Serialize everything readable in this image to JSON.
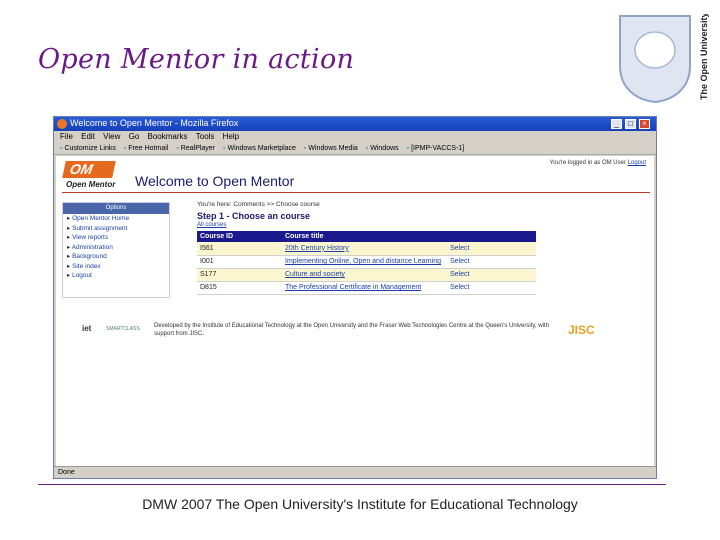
{
  "slide": {
    "title": "Open Mentor in action",
    "footer": "DMW 2007 The Open University's Institute for Educational Technology",
    "logo_caption": "The Open University",
    "accent_color": "#6a1a86"
  },
  "browser": {
    "window_title": "Welcome to Open Mentor - Mozilla Firefox",
    "menu": [
      "File",
      "Edit",
      "View",
      "Go",
      "Bookmarks",
      "Tools",
      "Help"
    ],
    "bookmarks": [
      "Customize Links",
      "Free Hotmail",
      "RealPlayer",
      "Windows Marketplace",
      "Windows Media",
      "Windows",
      "[IPMP-VACCS-1]"
    ],
    "status": "Done"
  },
  "page": {
    "logo_mark": "OM",
    "logo_text": "Open Mentor",
    "heading": "Welcome to Open Mentor",
    "user_line": "You're logged in as OM User",
    "logout_label": "Logout",
    "sidebar": {
      "header": "Options",
      "items": [
        "Open Mentor Home",
        "Submit assignment",
        "View reports",
        "Administration",
        "Background",
        "Site index",
        "Logout"
      ]
    },
    "breadcrumb": "You're here: Comments >> Choose course",
    "step_title": "Step 1 - Choose an course",
    "sub_link": "All courses",
    "table": {
      "headers": [
        "Course ID",
        "Course title",
        ""
      ],
      "rows": [
        {
          "id": "I561",
          "title": "20th Century History",
          "action": "Select"
        },
        {
          "id": "I001",
          "title": "Implementing Online, Open and distance Learning",
          "action": "Select"
        },
        {
          "id": "S177",
          "title": "Culture and society",
          "action": "Select"
        },
        {
          "id": "D815",
          "title": "The Professional Certificate in Management",
          "action": "Select"
        }
      ]
    },
    "funding_text": "Developed by the Institute of Educational Technology at the Open University and the Fraser Web Technologies Centre at the Queen's University, with support from JISC.",
    "partner_iet": "iet",
    "partner_gsw": "SMARTCLASS",
    "partner_jisc": "JISC"
  }
}
